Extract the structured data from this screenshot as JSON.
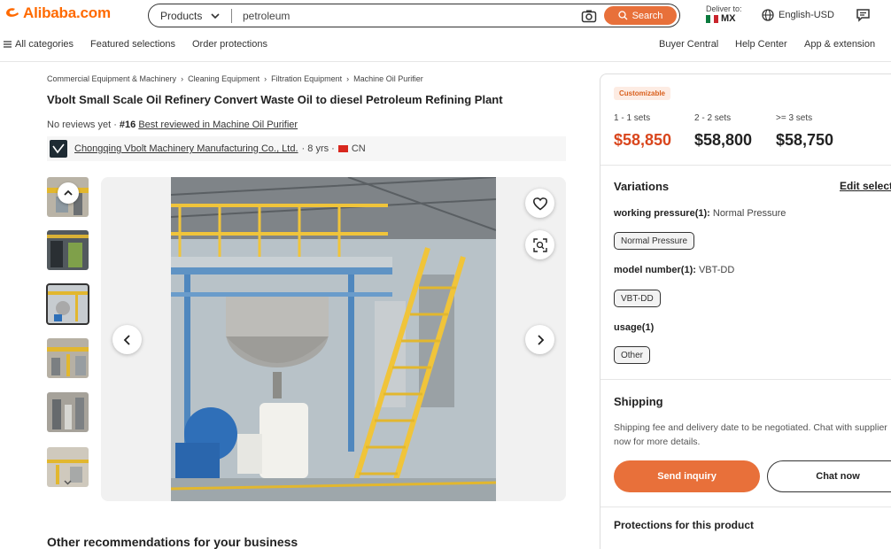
{
  "header": {
    "logo_text": "Alibaba.com",
    "search_type": "Products",
    "search_value": "petroleum",
    "search_button": "Search",
    "deliver_label": "Deliver to:",
    "deliver_country": "MX",
    "language": "English-USD"
  },
  "nav": {
    "all_categories": "All categories",
    "featured": "Featured selections",
    "protections": "Order protections",
    "buyer_central": "Buyer Central",
    "help_center": "Help Center",
    "app_extension": "App & extension"
  },
  "breadcrumb": [
    "Commercial Equipment & Machinery",
    "Cleaning Equipment",
    "Filtration Equipment",
    "Machine Oil Purifier"
  ],
  "product": {
    "title": "Vbolt Small Scale Oil Refinery Convert Waste Oil to diesel Petroleum Refining Plant",
    "reviews_prefix": "No reviews yet ·",
    "rank": "#16",
    "rank_link": "Best reviewed in Machine Oil Purifier",
    "supplier_name": "Chongqing Vbolt Machinery Manufacturing Co., Ltd.",
    "supplier_years": "· 8 yrs ·",
    "supplier_country": "CN"
  },
  "recommendations_title": "Other recommendations for your business",
  "panel": {
    "badge": "Customizable",
    "tiers": [
      {
        "qty": "1 - 1 sets",
        "price": "$58,850"
      },
      {
        "qty": "2 - 2 sets",
        "price": "$58,800"
      },
      {
        "qty": ">= 3 sets",
        "price": "$58,750"
      }
    ],
    "variations_title": "Variations",
    "edit_selection": "Edit selections",
    "variations": [
      {
        "name": "working pressure(1):",
        "value": "Normal Pressure",
        "chip": "Normal Pressure"
      },
      {
        "name": "model number(1):",
        "value": "VBT-DD",
        "chip": "VBT-DD"
      },
      {
        "name": "usage(1)",
        "value": "",
        "chip": "Other"
      }
    ],
    "shipping_title": "Shipping",
    "shipping_text": "Shipping fee and delivery date to be negotiated. Chat with supplier now for more details.",
    "send_inquiry": "Send inquiry",
    "chat_now": "Chat now",
    "protections_title": "Protections for this product"
  },
  "colors": {
    "brand": "#ff6a00",
    "accent_button": "#e8703a",
    "price_highlight": "#d9461d"
  },
  "icons": [
    "alibaba-logo-icon",
    "chevron-down-icon",
    "camera-search-icon",
    "search-icon",
    "mx-flag-icon",
    "globe-icon",
    "message-icon",
    "menu-icon",
    "heart-icon",
    "image-search-icon",
    "chevron-left-icon",
    "chevron-right-icon",
    "chevron-up-icon"
  ]
}
